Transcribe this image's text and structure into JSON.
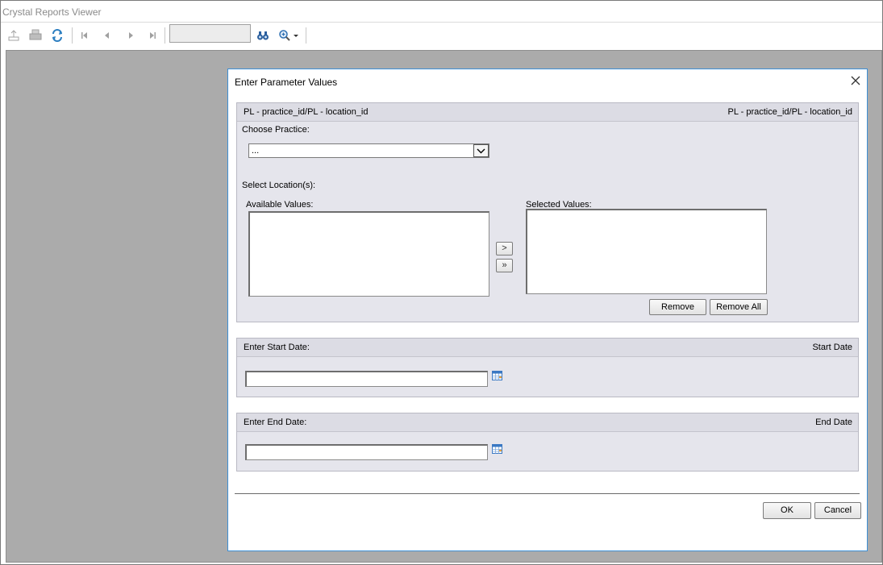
{
  "app": {
    "title": "Crystal Reports Viewer"
  },
  "toolbar": {
    "export_icon": "export-icon",
    "print_icon": "print-icon",
    "refresh_icon": "refresh-icon",
    "first_icon": "first-page-icon",
    "prev_icon": "previous-page-icon",
    "next_icon": "next-page-icon",
    "last_icon": "last-page-icon",
    "page_value": "",
    "find_icon": "binoculars-icon",
    "zoom_icon": "zoom-icon"
  },
  "dialog": {
    "title": "Enter Parameter Values",
    "close_icon": "close-icon",
    "location_panel": {
      "header_left": "PL - practice_id/PL - location_id",
      "header_right": "PL - practice_id/PL - location_id",
      "practice_label": "Choose Practice:",
      "practice_value": "...",
      "location_label": "Select Location(s):",
      "available_label": "Available Values:",
      "selected_label": "Selected Values:",
      "add_label": ">",
      "add_all_label": "»",
      "remove_label": "Remove",
      "remove_all_label": "Remove All"
    },
    "start_panel": {
      "header_left": "Enter Start Date:",
      "header_right": "Start Date",
      "value": "",
      "calendar_icon": "calendar-icon"
    },
    "end_panel": {
      "header_left": "Enter End Date:",
      "header_right": "End Date",
      "value": "",
      "calendar_icon": "calendar-icon"
    },
    "ok_label": "OK",
    "cancel_label": "Cancel"
  },
  "colors": {
    "viewer_bg": "#ababab",
    "panel_bg": "#e5e5ec",
    "dialog_border": "#3c8fd6"
  }
}
